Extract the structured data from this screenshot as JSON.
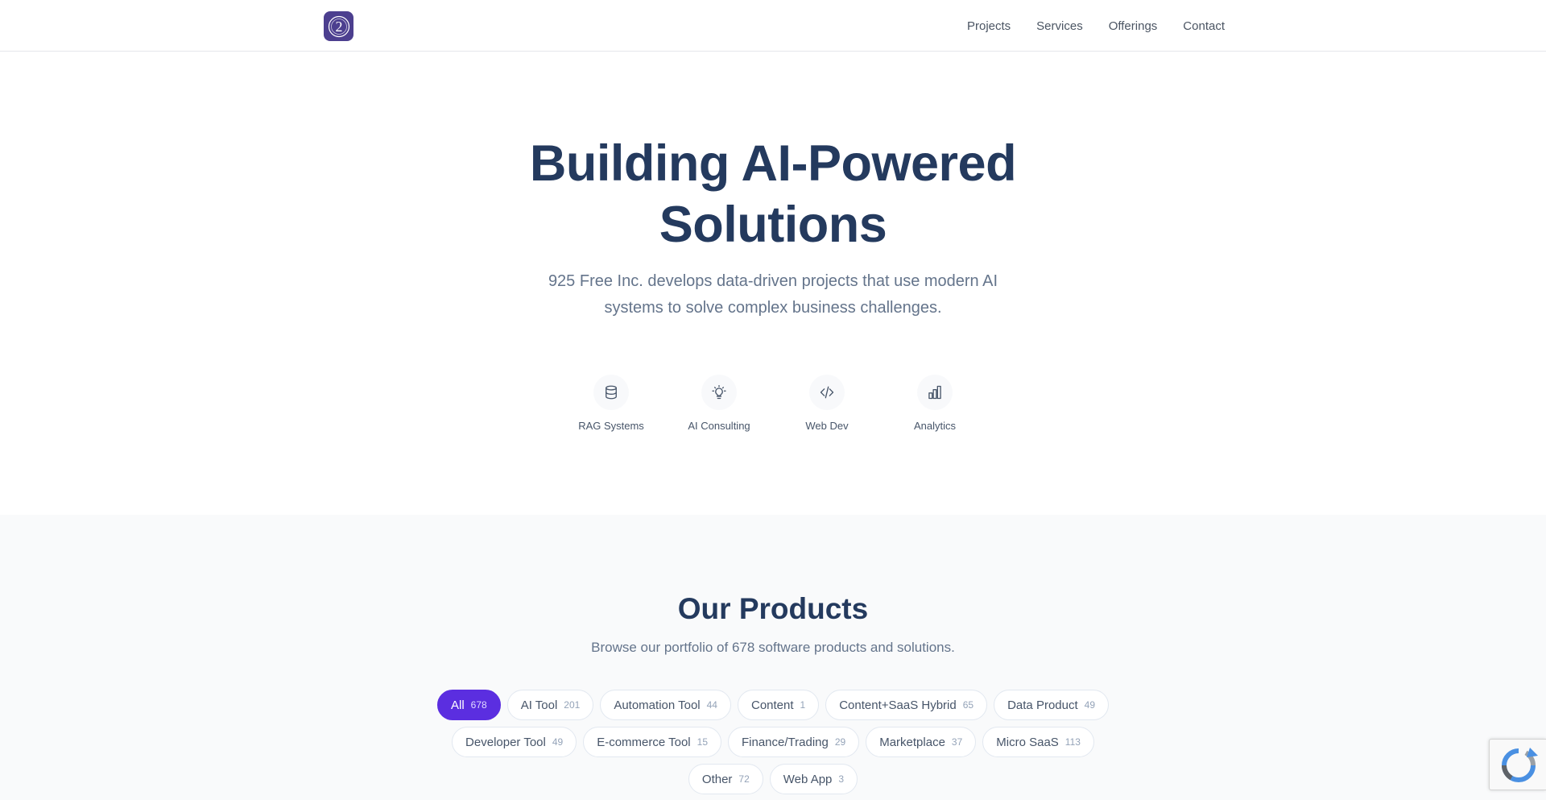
{
  "nav": {
    "logo_glyph": "2",
    "items": [
      "Projects",
      "Services",
      "Offerings",
      "Contact"
    ]
  },
  "hero": {
    "title_line1": "Building AI-Powered",
    "title_line2": "Solutions",
    "subtitle_line1": "925 Free Inc. develops data-driven projects that use modern AI",
    "subtitle_line2": "systems to solve complex business challenges.",
    "services": [
      {
        "label": "RAG Systems",
        "icon": "database-icon"
      },
      {
        "label": "AI Consulting",
        "icon": "lightbulb-icon"
      },
      {
        "label": "Web Dev",
        "icon": "code-icon"
      },
      {
        "label": "Analytics",
        "icon": "bar-chart-icon"
      }
    ]
  },
  "products": {
    "title": "Our Products",
    "subtitle": "Browse our portfolio of 678 software products and solutions.",
    "filters": [
      {
        "label": "All",
        "count": "678",
        "active": true
      },
      {
        "label": "AI Tool",
        "count": "201"
      },
      {
        "label": "Automation Tool",
        "count": "44"
      },
      {
        "label": "Content",
        "count": "1"
      },
      {
        "label": "Content+SaaS Hybrid",
        "count": "65"
      },
      {
        "label": "Data Product",
        "count": "49"
      },
      {
        "label": "Developer Tool",
        "count": "49"
      },
      {
        "label": "E-commerce Tool",
        "count": "15"
      },
      {
        "label": "Finance/Trading",
        "count": "29"
      },
      {
        "label": "Marketplace",
        "count": "37"
      },
      {
        "label": "Micro SaaS",
        "count": "113"
      },
      {
        "label": "Other",
        "count": "72"
      },
      {
        "label": "Web App",
        "count": "3"
      }
    ]
  },
  "colors": {
    "accent": "#5b2ee0",
    "heading": "#243a5e",
    "logo_bg": "#4c3f8f"
  }
}
